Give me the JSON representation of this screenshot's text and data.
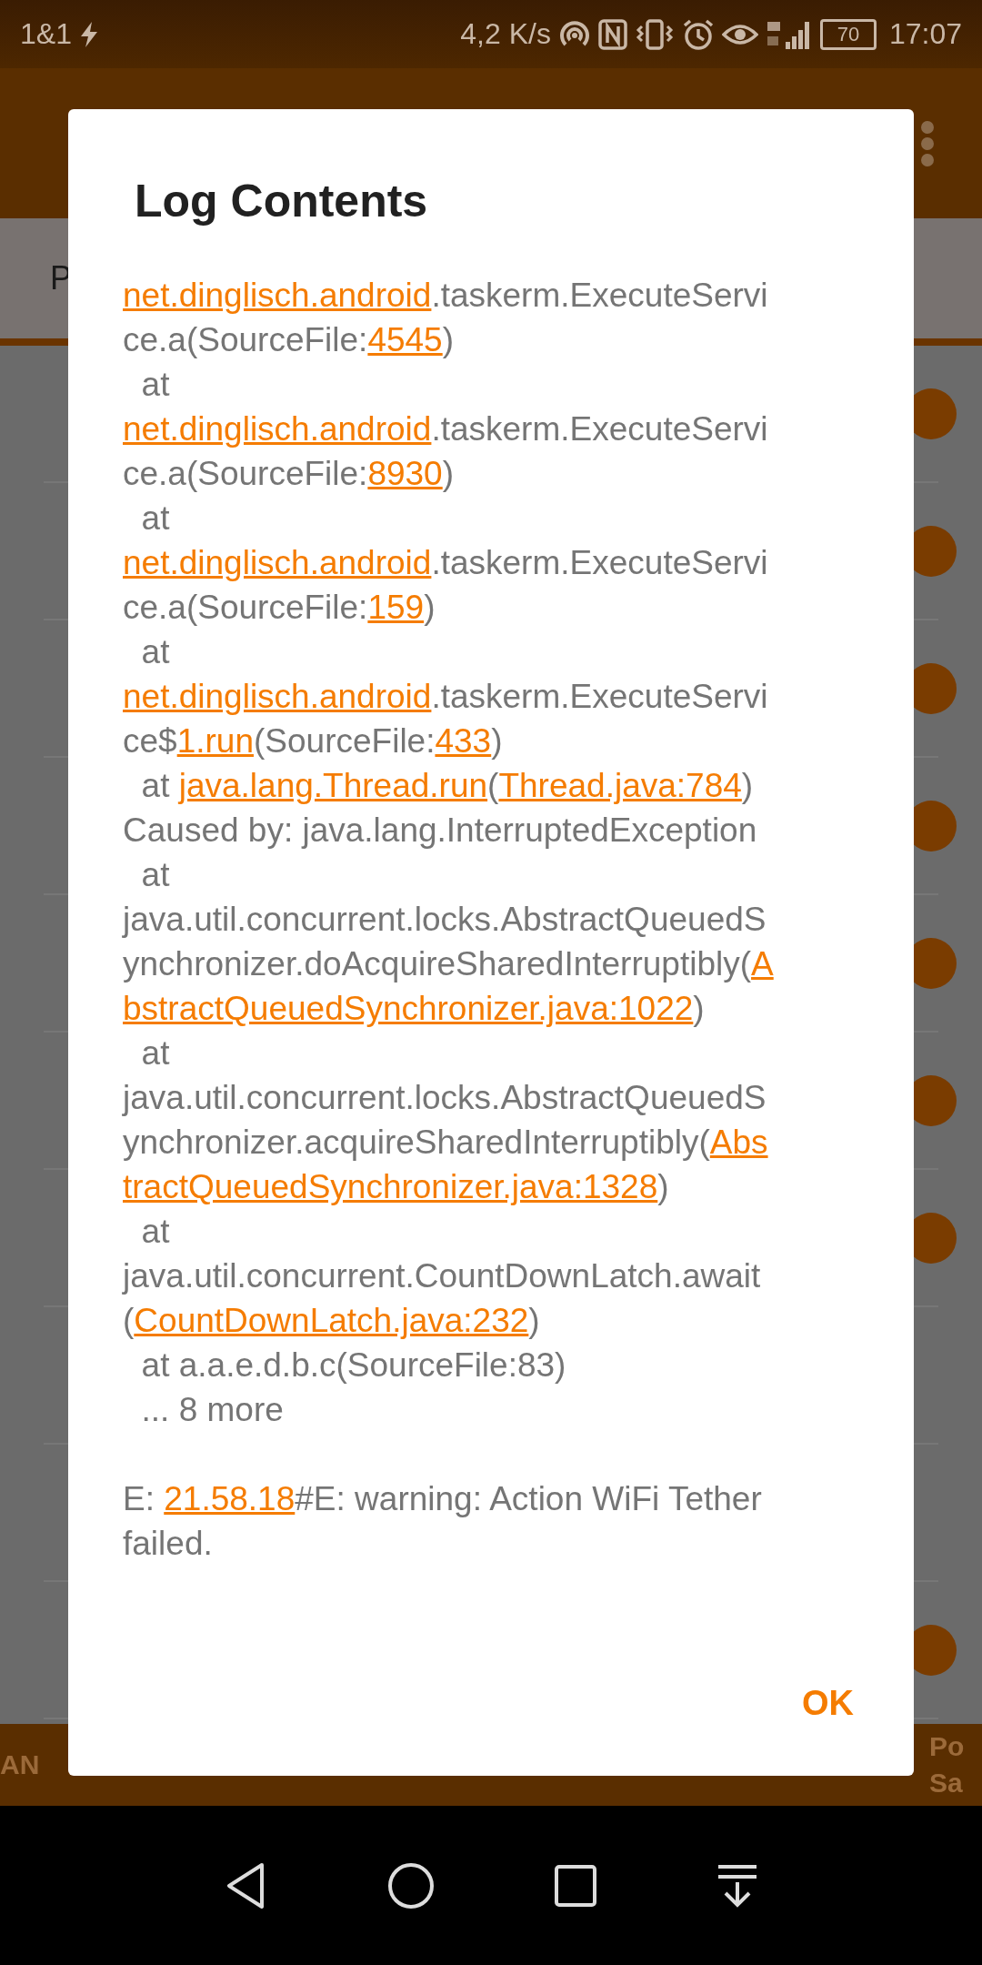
{
  "status_bar": {
    "carrier": "1&1",
    "speed": "4,2 K/s",
    "battery": "70",
    "time": "17:07"
  },
  "background": {
    "tab": "P",
    "rows": [
      {
        "kind": "switch"
      },
      {
        "kind": "switch"
      },
      {
        "kind": "switch"
      },
      {
        "kind": "switch"
      },
      {
        "kind": "switch"
      },
      {
        "kind": "switch"
      },
      {
        "kind": "switch"
      },
      {
        "kind": "plain"
      },
      {
        "kind": "plain"
      },
      {
        "kind": "switch"
      }
    ],
    "bottom_tabs": [
      {
        "label": "AN",
        "kind": "left"
      },
      {
        "label": "Po Sa",
        "kind": "right"
      }
    ]
  },
  "dialog": {
    "title": "Log Contents",
    "paragraphs": [
      {
        "lines": [
          [
            {
              "text": "net.dinglisch.android",
              "kind": "link"
            },
            {
              "text": ".taskerm.ExecuteServi",
              "kind": "text"
            }
          ],
          [
            {
              "text": "ce.a(SourceFile:",
              "kind": "text"
            },
            {
              "text": "4545",
              "kind": "link"
            },
            {
              "text": ")",
              "kind": "text"
            }
          ],
          [
            {
              "text": "  at",
              "kind": "text"
            }
          ],
          [
            {
              "text": "net.dinglisch.android",
              "kind": "link"
            },
            {
              "text": ".taskerm.ExecuteServi",
              "kind": "text"
            }
          ],
          [
            {
              "text": "ce.a(SourceFile:",
              "kind": "text"
            },
            {
              "text": "8930",
              "kind": "link"
            },
            {
              "text": ")",
              "kind": "text"
            }
          ],
          [
            {
              "text": "  at",
              "kind": "text"
            }
          ],
          [
            {
              "text": "net.dinglisch.android",
              "kind": "link"
            },
            {
              "text": ".taskerm.ExecuteServi",
              "kind": "text"
            }
          ],
          [
            {
              "text": "ce.a(SourceFile:",
              "kind": "text"
            },
            {
              "text": "159",
              "kind": "link"
            },
            {
              "text": ")",
              "kind": "text"
            }
          ],
          [
            {
              "text": "  at",
              "kind": "text"
            }
          ],
          [
            {
              "text": "net.dinglisch.android",
              "kind": "link"
            },
            {
              "text": ".taskerm.ExecuteServi",
              "kind": "text"
            }
          ],
          [
            {
              "text": "ce$",
              "kind": "text"
            },
            {
              "text": "1.run",
              "kind": "link"
            },
            {
              "text": "(SourceFile:",
              "kind": "text"
            },
            {
              "text": "433",
              "kind": "link"
            },
            {
              "text": ")",
              "kind": "text"
            }
          ],
          [
            {
              "text": "  at ",
              "kind": "text"
            },
            {
              "text": "java.lang.Thread.run",
              "kind": "link"
            },
            {
              "text": "(",
              "kind": "text"
            },
            {
              "text": "Thread.java:784",
              "kind": "link"
            },
            {
              "text": ")",
              "kind": "text"
            }
          ],
          [
            {
              "text": "Caused by: java.lang.InterruptedException",
              "kind": "text"
            }
          ],
          [
            {
              "text": "  at",
              "kind": "text"
            }
          ],
          [
            {
              "text": "java.util.concurrent.locks.AbstractQueuedS",
              "kind": "text"
            }
          ],
          [
            {
              "text": "ynchronizer.doAcquireSharedInterruptibly(",
              "kind": "text"
            },
            {
              "text": "A",
              "kind": "link"
            }
          ],
          [
            {
              "text": "bstractQueuedSynchronizer.java:1022",
              "kind": "link"
            },
            {
              "text": ")",
              "kind": "text"
            }
          ],
          [
            {
              "text": "  at",
              "kind": "text"
            }
          ],
          [
            {
              "text": "java.util.concurrent.locks.AbstractQueuedS",
              "kind": "text"
            }
          ],
          [
            {
              "text": "ynchronizer.acquireSharedInterruptibly(",
              "kind": "text"
            },
            {
              "text": "Abs",
              "kind": "link"
            }
          ],
          [
            {
              "text": "tractQueuedSynchronizer.java:1328",
              "kind": "link"
            },
            {
              "text": ")",
              "kind": "text"
            }
          ],
          [
            {
              "text": "  at",
              "kind": "text"
            }
          ],
          [
            {
              "text": "java.util.concurrent.CountDownLatch.await",
              "kind": "text"
            }
          ],
          [
            {
              "text": "(",
              "kind": "text"
            },
            {
              "text": "CountDownLatch.java:232",
              "kind": "link"
            },
            {
              "text": ")",
              "kind": "text"
            }
          ],
          [
            {
              "text": "  at a.a.e.d.b.c(SourceFile:83)",
              "kind": "text"
            }
          ],
          [
            {
              "text": "  ... 8 more",
              "kind": "text"
            }
          ]
        ]
      },
      {
        "lines": [
          [
            {
              "text": "E: ",
              "kind": "text"
            },
            {
              "text": "21.58.18",
              "kind": "link"
            },
            {
              "text": "#E: warning: Action WiFi Tether",
              "kind": "text"
            }
          ],
          [
            {
              "text": "failed.",
              "kind": "text"
            }
          ]
        ]
      }
    ],
    "button": "OK"
  }
}
